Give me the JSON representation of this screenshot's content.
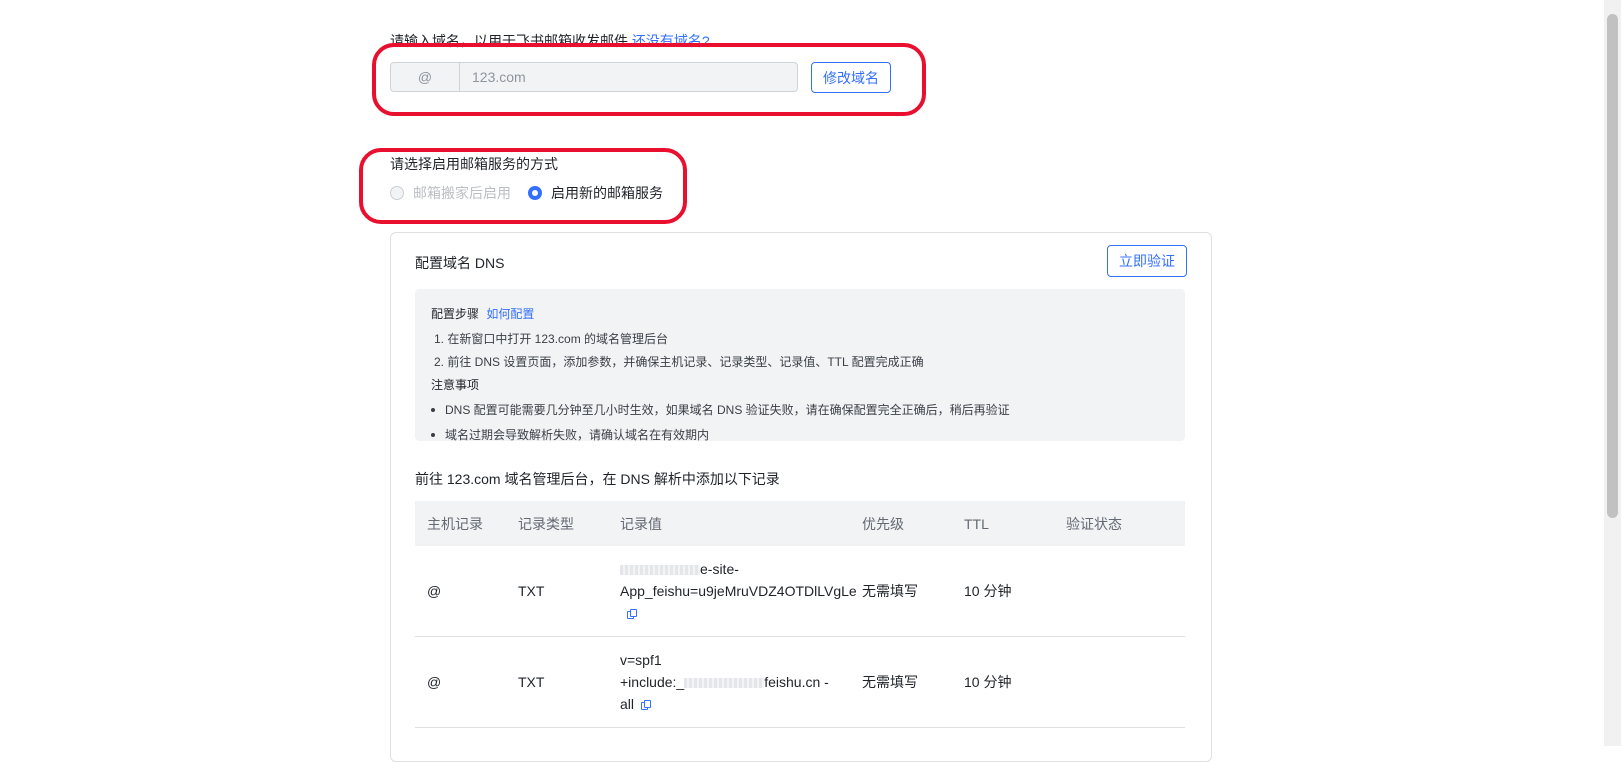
{
  "intro": {
    "text": "请输入域名，以用于飞书邮箱收发邮件",
    "link": "还没有域名?"
  },
  "domain": {
    "prefix": "@",
    "value": "123.com",
    "modify_button": "修改域名"
  },
  "mode": {
    "label": "请选择启用邮箱服务的方式",
    "options": [
      {
        "label": "邮箱搬家后启用",
        "selected": false,
        "disabled": true
      },
      {
        "label": "启用新的邮箱服务",
        "selected": true,
        "disabled": false
      }
    ]
  },
  "dns": {
    "title": "配置域名 DNS",
    "verify_button": "立即验证",
    "steps_title": "配置步骤",
    "how_link": "如何配置",
    "steps": [
      "1. 在新窗口中打开 123.com 的域名管理后台",
      "2. 前往 DNS 设置页面，添加参数，并确保主机记录、记录类型、记录值、TTL 配置完成正确"
    ],
    "notes_title": "注意事项",
    "notes": [
      "DNS 配置可能需要几分钟至几小时生效，如果域名 DNS 验证失败，请在确保配置完全正确后，稍后再验证",
      "域名过期会导致解析失败，请确认域名在有效期内"
    ],
    "description": "前往 123.com 域名管理后台，在 DNS 解析中添加以下记录",
    "columns": [
      "主机记录",
      "记录类型",
      "记录值",
      "优先级",
      "TTL",
      "验证状态"
    ],
    "records": [
      {
        "host": "@",
        "type": "TXT",
        "value_line1_end": "e-site-",
        "value_rest": "App_feishu=u9jeMruVDZ4OTDlLVgLe",
        "priority": "无需填写",
        "ttl": "10 分钟",
        "status": ""
      },
      {
        "host": "@",
        "type": "TXT",
        "value_line1": "v=spf1",
        "value_line2_start": "+include:_",
        "value_line2_end": "feishu.cn -",
        "value_line3": "all",
        "priority": "无需填写",
        "ttl": "10 分钟",
        "status": ""
      }
    ]
  },
  "colors": {
    "accent": "#3370ff",
    "annotation": "#e8102e"
  }
}
